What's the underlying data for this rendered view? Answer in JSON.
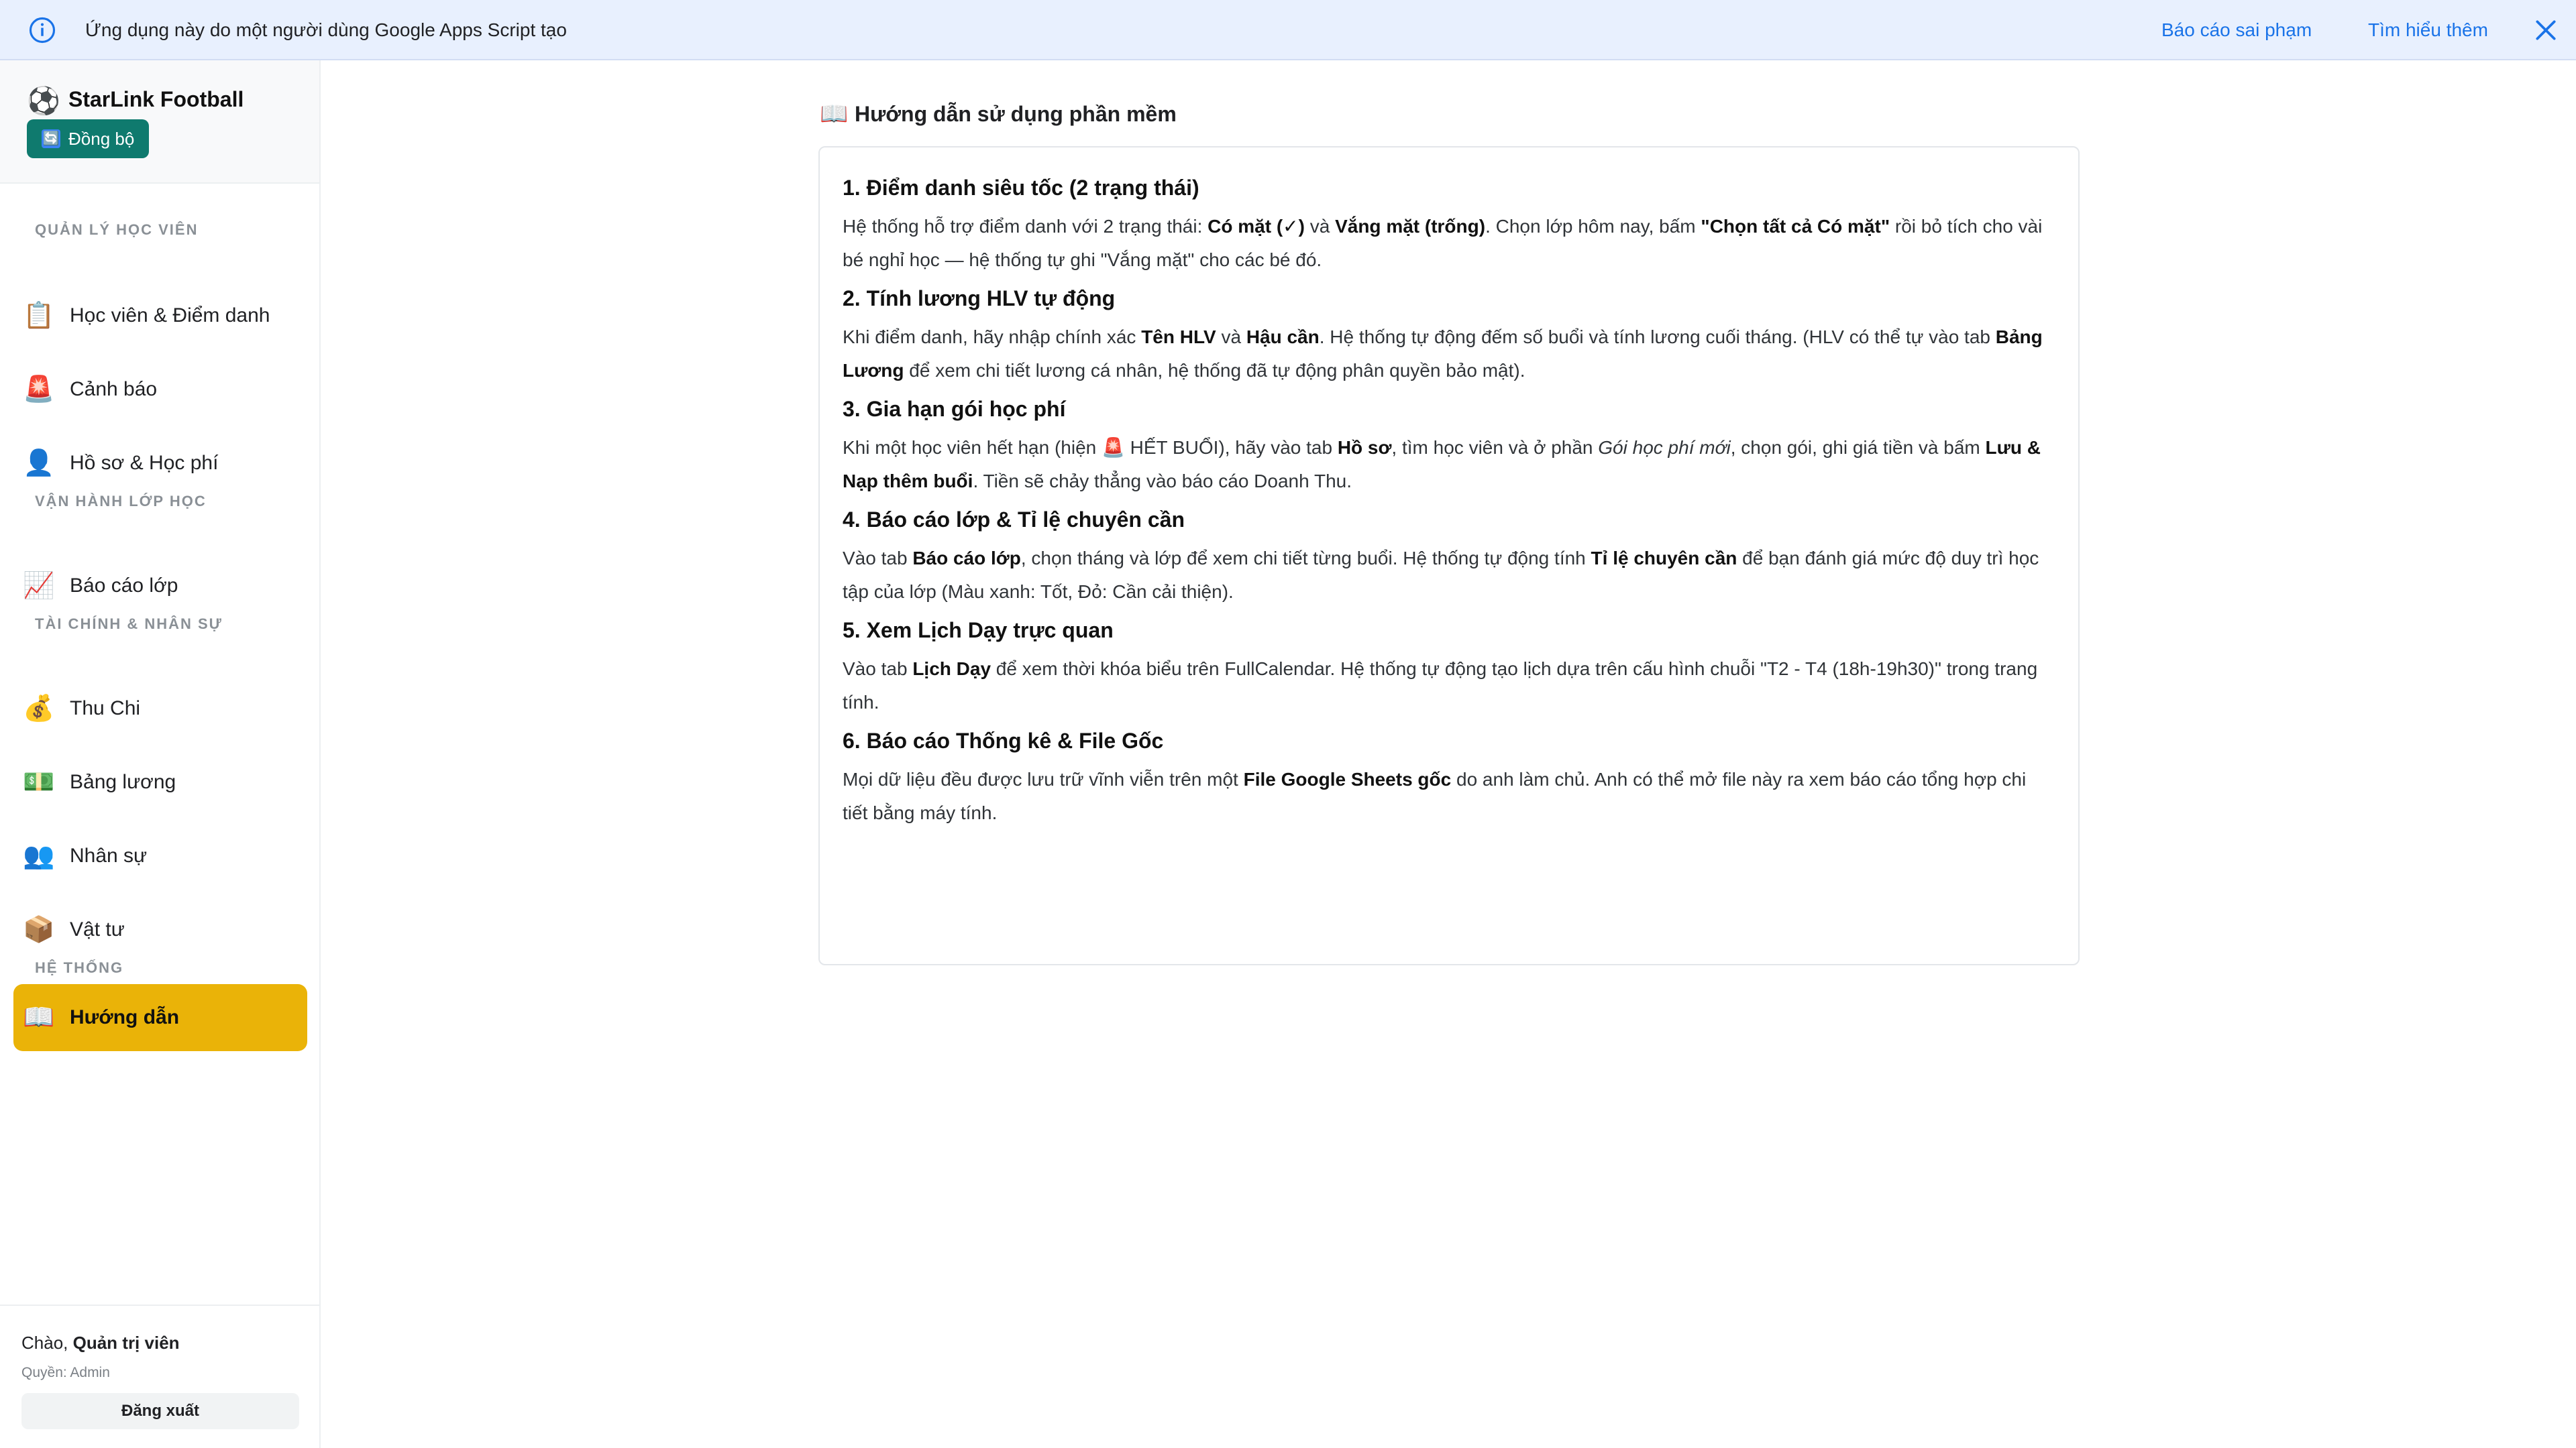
{
  "banner": {
    "text": "Ứng dụng này do một người dùng Google Apps Script tạo",
    "report_link": "Báo cáo sai phạm",
    "learn_link": "Tìm hiểu thêm"
  },
  "brand": {
    "name": "StarLink Football",
    "sync_label": "Đồng bộ"
  },
  "sidebar": {
    "sections": [
      {
        "title": "QUẢN LÝ HỌC VIÊN"
      },
      {
        "title": "VẬN HÀNH LỚP HỌC"
      },
      {
        "title": "TÀI CHÍNH & NHÂN SỰ"
      },
      {
        "title": "HỆ THỐNG"
      }
    ],
    "items": [
      {
        "label": "Học viên & Điểm danh",
        "icon": "clipboard-icon"
      },
      {
        "label": "Cảnh báo",
        "icon": "siren-icon"
      },
      {
        "label": "Hồ sơ & Học phí",
        "icon": "person-icon"
      },
      {
        "label": "Báo cáo lớp",
        "icon": "chart-icon"
      },
      {
        "label": "Thu Chi",
        "icon": "money-bag-icon"
      },
      {
        "label": "Bảng lương",
        "icon": "banknote-icon"
      },
      {
        "label": "Nhân sự",
        "icon": "people-icon"
      },
      {
        "label": "Vật tư",
        "icon": "box-icon"
      },
      {
        "label": "Hướng dẫn",
        "icon": "book-icon",
        "active": true
      }
    ]
  },
  "user": {
    "greeting_prefix": "Chào, ",
    "name": "Quản trị viên",
    "role": "Quyền: Admin",
    "logout_label": "Đăng xuất"
  },
  "main": {
    "title": "Hướng dẫn sử dụng phần mềm",
    "sections": [
      {
        "heading": "1. Điểm danh siêu tốc (2 trạng thái)"
      },
      {
        "heading": "2. Tính lương HLV tự động"
      },
      {
        "heading": "3. Gia hạn gói học phí"
      },
      {
        "heading": "4. Báo cáo lớp & Tỉ lệ chuyên cần"
      },
      {
        "heading": "5. Xem Lịch Dạy trực quan"
      },
      {
        "heading": "6. Báo cáo Thống kê & File Gốc"
      }
    ],
    "s1": {
      "t1": "Hệ thống hỗ trợ điểm danh với 2 trạng thái: ",
      "b1": "Có mặt (✓)",
      "t2": " và ",
      "b2": "Vắng mặt (trống)",
      "t3": ". Chọn lớp hôm nay, bấm ",
      "b3": "\"Chọn tất cả Có mặt\"",
      "t4": " rồi bỏ tích cho vài bé nghỉ học — hệ thống tự ghi \"Vắng mặt\" cho các bé đó."
    },
    "s2": {
      "t1": "Khi điểm danh, hãy nhập chính xác ",
      "b1": "Tên HLV",
      "t2": " và ",
      "b2": "Hậu cần",
      "t3": ". Hệ thống tự động đếm số buổi và tính lương cuối tháng. (HLV có thể tự vào tab ",
      "b3": "Bảng Lương",
      "t4": " để xem chi tiết lương cá nhân, hệ thống đã tự động phân quyền bảo mật)."
    },
    "s3": {
      "t1": "Khi một học viên hết hạn (hiện 🚨 HẾT BUỔI), hãy vào tab ",
      "b1": "Hồ sơ",
      "t2": ", tìm học viên và ở phần ",
      "i1": "Gói học phí mới",
      "t3": ", chọn gói, ghi giá tiền và bấm ",
      "b2": "Lưu & Nạp thêm buổi",
      "t4": ". Tiền sẽ chảy thẳng vào báo cáo Doanh Thu."
    },
    "s4": {
      "t1": "Vào tab ",
      "b1": "Báo cáo lớp",
      "t2": ", chọn tháng và lớp để xem chi tiết từng buổi. Hệ thống tự động tính ",
      "b2": "Tỉ lệ chuyên cần",
      "t3": " để bạn đánh giá mức độ duy trì học tập của lớp (Màu xanh: Tốt, Đỏ: Cần cải thiện)."
    },
    "s5": {
      "t1": "Vào tab ",
      "b1": "Lịch Dạy",
      "t2": " để xem thời khóa biểu trên FullCalendar. Hệ thống tự động tạo lịch dựa trên cấu hình chuỗi \"T2 - T4 (18h-19h30)\" trong trang tính."
    },
    "s6": {
      "t1": "Mọi dữ liệu đều được lưu trữ vĩnh viễn trên một ",
      "b1": "File Google Sheets gốc",
      "t2": " do anh làm chủ. Anh có thể mở file này ra xem báo cáo tổng hợp chi tiết bằng máy tính."
    }
  },
  "colors": {
    "banner_bg": "#e8f0fe",
    "link_blue": "#1a73e8",
    "sync_green": "#0f7a6e",
    "active_yellow": "#eab308"
  }
}
